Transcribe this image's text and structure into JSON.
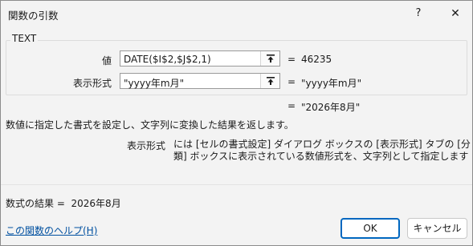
{
  "window": {
    "title": "関数の引数",
    "help_glyph": "?",
    "close_glyph": "✕"
  },
  "function": {
    "name": "TEXT",
    "args": [
      {
        "label": "値",
        "value": "DATE($I$2,$J$2,1)",
        "result": "46235"
      },
      {
        "label": "表示形式",
        "value": "\"yyyy年m月\"",
        "result": "\"yyyy年m月\""
      }
    ],
    "equals": "=",
    "overall_result": "\"2026年8月\""
  },
  "description": {
    "function_desc": "数値に指定した書式を設定し、文字列に変換した結果を返します。",
    "arg_name": "表示形式",
    "arg_desc": "には [セルの書式設定] ダイアログ ボックスの [表示形式] タブの [分類] ボックスに表示されている数値形式を、文字列として指定します"
  },
  "footer": {
    "formula_result_label": "数式の結果 =",
    "formula_result_value": "2026年8月",
    "help_link": "この関数のヘルプ(H)",
    "ok_label": "OK",
    "cancel_label": "キャンセル"
  },
  "icons": {
    "collapse": "collapse-dialog-icon"
  },
  "colors": {
    "background": "#f3f3f3",
    "accent": "#0067c0",
    "link": "#0050a0"
  }
}
